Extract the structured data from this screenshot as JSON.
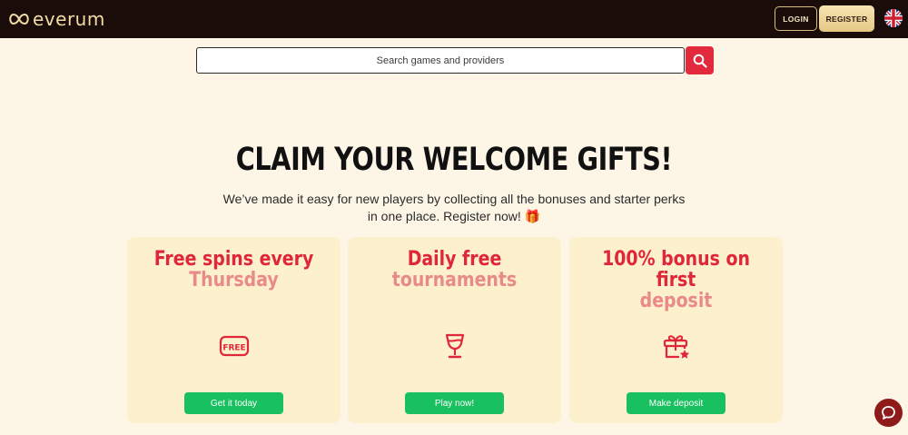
{
  "header": {
    "logo_text": "everum",
    "login_label": "LOGIN",
    "register_label": "REGISTER",
    "language_icon": "uk-flag-icon"
  },
  "search": {
    "placeholder": "Search games and providers",
    "icon": "search-icon"
  },
  "hero": {
    "title": "CLAIM YOUR WELCOME GIFTS!",
    "subtitle": "We’ve made it easy for new players by collecting all the bonuses and starter perks in one place. Register now! 🎁"
  },
  "cards": [
    {
      "title_line1": "Free spins every",
      "title_line2": "Thursday",
      "icon": "free-badge-icon",
      "button_label": "Get it today"
    },
    {
      "title_line1": "Daily free",
      "title_line2": "tournaments",
      "icon": "trophy-icon",
      "button_label": "Play now!"
    },
    {
      "title_line1": "100% bonus on first",
      "title_line2": "deposit",
      "icon": "gift-star-icon",
      "button_label": "Make deposit"
    }
  ],
  "colors": {
    "header_bg": "#1a0c08",
    "page_bg": "#fdf6e7",
    "accent_red": "#e0263a",
    "accent_green": "#19c060",
    "gold": "#e5c783"
  },
  "chat": {
    "icon": "chat-bubble-icon"
  }
}
